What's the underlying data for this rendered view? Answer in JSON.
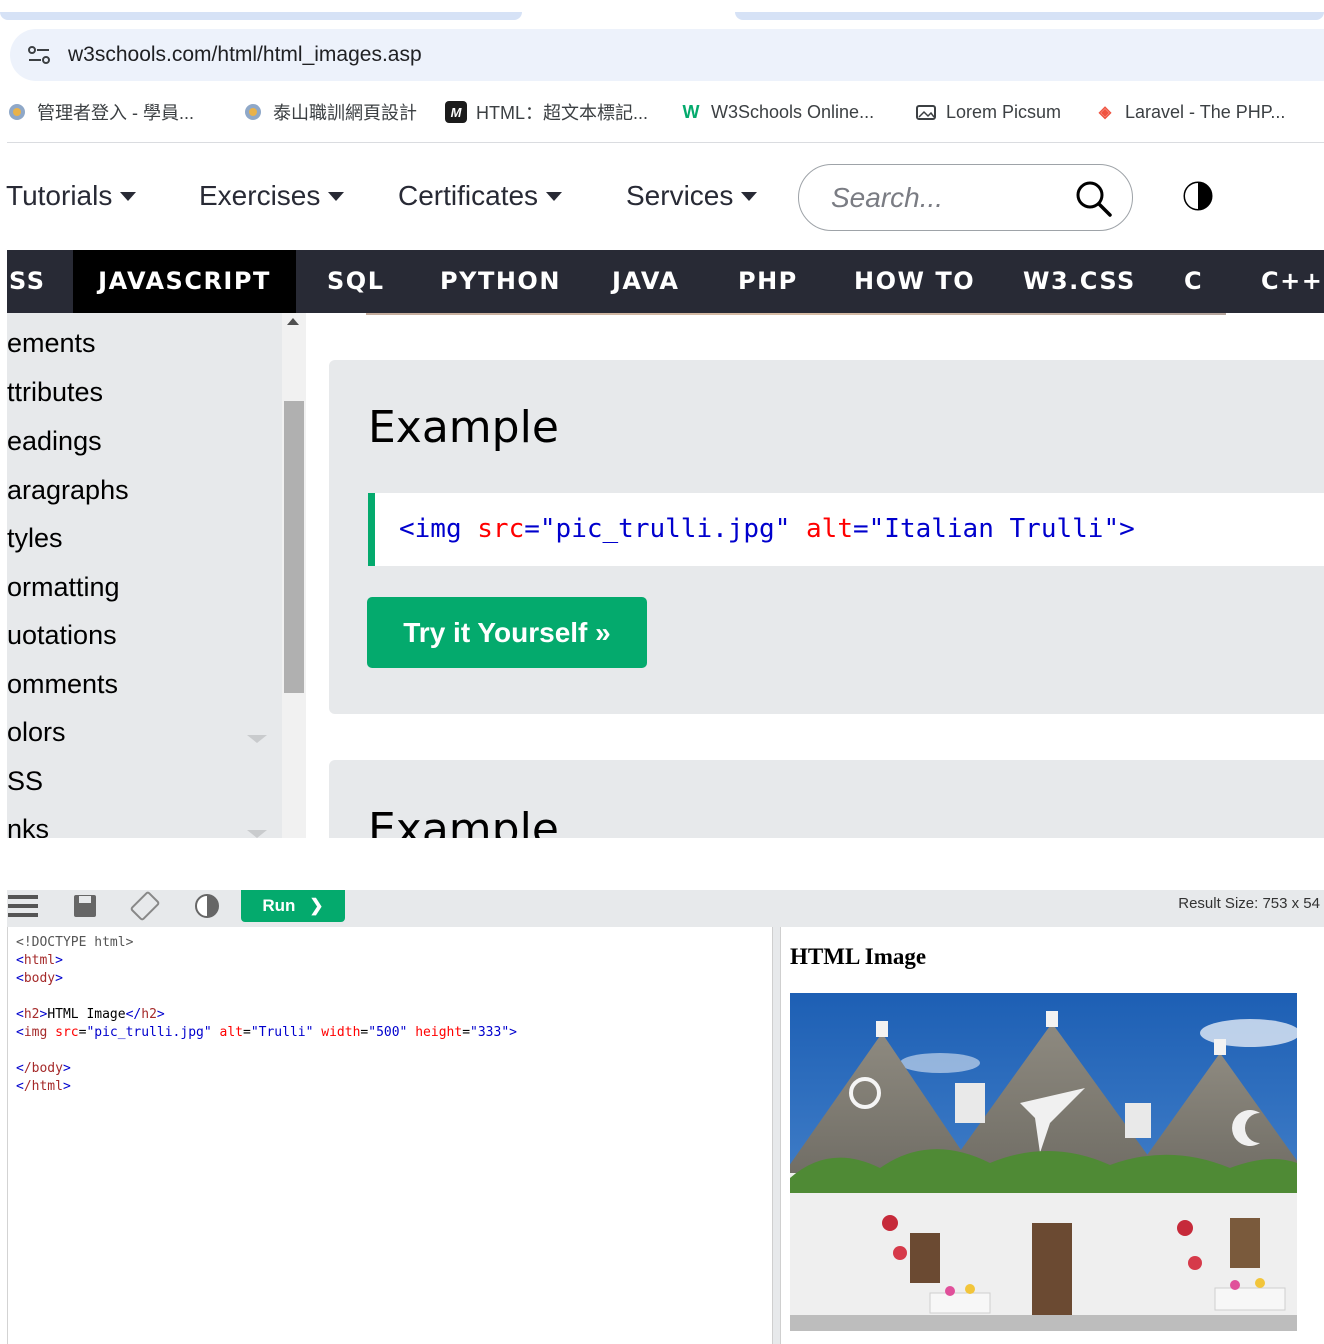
{
  "browser": {
    "url": "w3schools.com/html/html_images.asp",
    "bookmarks": [
      {
        "label": "管理者登入 - 學員...",
        "icon": "globe-icon"
      },
      {
        "label": "泰山職訓網頁設計",
        "icon": "globe-icon"
      },
      {
        "label": "HTML：超文本標記...",
        "icon": "mdn-logo-icon"
      },
      {
        "label": "W3Schools Online...",
        "icon": "w3schools-logo-icon"
      },
      {
        "label": "Lorem Picsum",
        "icon": "picture-icon"
      },
      {
        "label": "Laravel - The PHP...",
        "icon": "laravel-logo-icon"
      }
    ]
  },
  "topnav": {
    "menus": [
      "Tutorials",
      "Exercises",
      "Certificates",
      "Services"
    ],
    "search_placeholder": "Search..."
  },
  "langbar": {
    "items": [
      "SS",
      "JAVASCRIPT",
      "SQL",
      "PYTHON",
      "JAVA",
      "PHP",
      "HOW TO",
      "W3.CSS",
      "C",
      "C++"
    ],
    "active": "JAVASCRIPT"
  },
  "sidebar": {
    "items": [
      "ements",
      "ttributes",
      "eadings",
      "aragraphs",
      "tyles",
      "ormatting",
      "uotations",
      "omments",
      "olors",
      "SS",
      "nks"
    ]
  },
  "main": {
    "example1": {
      "title": "Example",
      "code": {
        "tag_open": "<img",
        "attr1": "src",
        "val1": "\"pic_trulli.jpg\"",
        "attr2": "alt",
        "val2": "\"Italian Trulli\"",
        "tag_close": ">"
      },
      "try_label": "Try it Yourself »"
    },
    "example2": {
      "title": "Example"
    }
  },
  "editor": {
    "run_label": "Run",
    "result_size": "Result Size: 753 x 54",
    "code_lines": {
      "l1": "<!DOCTYPE html>",
      "l2": "html",
      "l3": "body",
      "l5_tag": "h2",
      "l5_text": "HTML Image",
      "l6_tag": "img",
      "l6_a1": "src",
      "l6_v1": "\"pic_trulli.jpg\"",
      "l6_a2": "alt",
      "l6_v2": "\"Trulli\"",
      "l6_a3": "width",
      "l6_v3": "\"500\"",
      "l6_a4": "height",
      "l6_v4": "\"333\"",
      "l8_tag": "/body",
      "l9_tag": "/html"
    },
    "result": {
      "heading": "HTML Image"
    }
  },
  "colors": {
    "accent_green": "#04aa6d",
    "dark_bar": "#282a35",
    "sidebar_bg": "#e7e9eb"
  }
}
